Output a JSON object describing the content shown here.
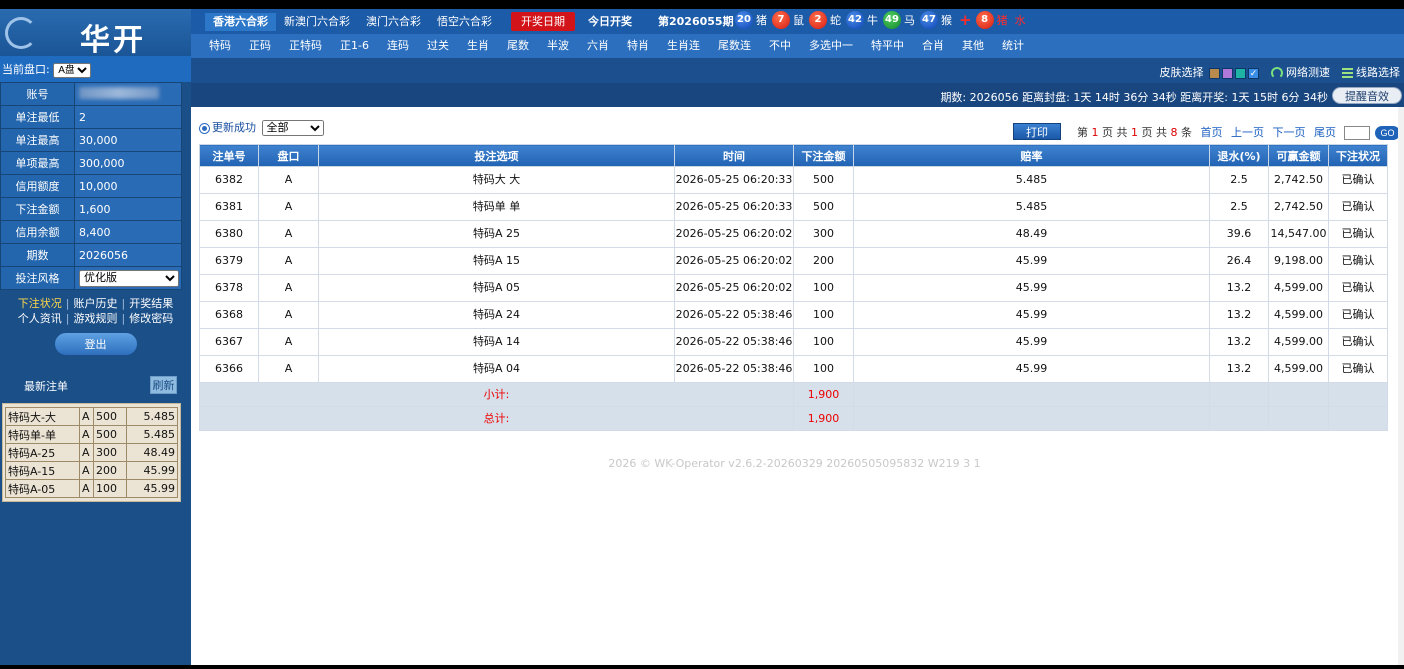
{
  "logo": {
    "name": "华开"
  },
  "sidebar": {
    "pan_label": "当前盘口:",
    "pan_value": "A盘",
    "info": [
      {
        "k": "账号",
        "v": ""
      },
      {
        "k": "单注最低",
        "v": "2"
      },
      {
        "k": "单注最高",
        "v": "30,000"
      },
      {
        "k": "单项最高",
        "v": "300,000"
      },
      {
        "k": "信用额度",
        "v": "10,000"
      },
      {
        "k": "下注金额",
        "v": "1,600"
      },
      {
        "k": "信用余额",
        "v": "8,400"
      },
      {
        "k": "期数",
        "v": "2026056"
      },
      {
        "k": "投注风格",
        "v": "优化版"
      }
    ],
    "links_row1": [
      "下注状况",
      "账户历史",
      "开奖结果"
    ],
    "links_row2": [
      "个人资讯",
      "游戏规则",
      "修改密码"
    ],
    "logout": "登出",
    "recent_title": "最新注单",
    "refresh": "刷新",
    "recent": [
      {
        "item": "特码大-大",
        "pan": "A",
        "amt": "500",
        "odds": "5.485"
      },
      {
        "item": "特码单-单",
        "pan": "A",
        "amt": "500",
        "odds": "5.485"
      },
      {
        "item": "特码A-25",
        "pan": "A",
        "amt": "300",
        "odds": "48.49"
      },
      {
        "item": "特码A-15",
        "pan": "A",
        "amt": "200",
        "odds": "45.99"
      },
      {
        "item": "特码A-05",
        "pan": "A",
        "amt": "100",
        "odds": "45.99"
      }
    ]
  },
  "top": {
    "tabs": [
      "香港六合彩",
      "新澳门六合彩",
      "澳门六合彩",
      "悟空六合彩"
    ],
    "draw_date_btn": "开奖日期",
    "today": "今日开奖",
    "period": "第2026055期",
    "balls": [
      {
        "n": "20",
        "color": "blue",
        "zodiac": "猪"
      },
      {
        "n": "7",
        "color": "red",
        "zodiac": "鼠"
      },
      {
        "n": "2",
        "color": "red",
        "zodiac": "蛇"
      },
      {
        "n": "42",
        "color": "blue",
        "zodiac": "牛"
      },
      {
        "n": "49",
        "color": "green",
        "zodiac": "马"
      },
      {
        "n": "47",
        "color": "blue",
        "zodiac": "猴"
      }
    ],
    "special": {
      "n": "8",
      "color": "red",
      "zodiac": "猪",
      "extra": "水"
    }
  },
  "nav": [
    "特码",
    "正码",
    "正特码",
    "正1-6",
    "连码",
    "过关",
    "生肖",
    "尾数",
    "半波",
    "六肖",
    "特肖",
    "生肖连",
    "尾数连",
    "不中",
    "多选中一",
    "特平中",
    "合肖",
    "其他",
    "统计"
  ],
  "toolbar": {
    "skin_label": "皮肤选择",
    "skin_colors": [
      "#b88a4e",
      "#b078d8",
      "#1fb3a6",
      "#3a8ee6"
    ],
    "netspeed": "网络测速",
    "lines": "线路选择",
    "status_text": "期数: 2026056   距离封盘: 1天 14时 36分 34秒  距离开奖: 1天 15时 6分 34秒",
    "sound_btn": "提醒音效"
  },
  "filter": {
    "label": "更新成功",
    "value": "全部"
  },
  "print_btn": "打印",
  "pager": {
    "page": "1",
    "total_pages": "1",
    "total_items": "8",
    "first": "首页",
    "prev": "上一页",
    "next": "下一页",
    "last": "尾页",
    "go": "GO"
  },
  "table": {
    "headers": [
      "注单号",
      "盘口",
      "投注选项",
      "时间",
      "下注金额",
      "赔率",
      "退水(%)",
      "可赢金额",
      "下注状况"
    ],
    "rows": [
      [
        "6382",
        "A",
        "特码大 大",
        "2026-05-25 06:20:33",
        "500",
        "5.485",
        "2.5",
        "2,742.50",
        "已确认"
      ],
      [
        "6381",
        "A",
        "特码单 单",
        "2026-05-25 06:20:33",
        "500",
        "5.485",
        "2.5",
        "2,742.50",
        "已确认"
      ],
      [
        "6380",
        "A",
        "特码A 25",
        "2026-05-25 06:20:02",
        "300",
        "48.49",
        "39.6",
        "14,547.00",
        "已确认"
      ],
      [
        "6379",
        "A",
        "特码A 15",
        "2026-05-25 06:20:02",
        "200",
        "45.99",
        "26.4",
        "9,198.00",
        "已确认"
      ],
      [
        "6378",
        "A",
        "特码A 05",
        "2026-05-25 06:20:02",
        "100",
        "45.99",
        "13.2",
        "4,599.00",
        "已确认"
      ],
      [
        "6368",
        "A",
        "特码A 24",
        "2026-05-22 05:38:46",
        "100",
        "45.99",
        "13.2",
        "4,599.00",
        "已确认"
      ],
      [
        "6367",
        "A",
        "特码A 14",
        "2026-05-22 05:38:46",
        "100",
        "45.99",
        "13.2",
        "4,599.00",
        "已确认"
      ],
      [
        "6366",
        "A",
        "特码A 04",
        "2026-05-22 05:38:46",
        "100",
        "45.99",
        "13.2",
        "4,599.00",
        "已确认"
      ]
    ],
    "subtotal_label": "小计:",
    "subtotal": "1,900",
    "total_label": "总计:",
    "total": "1,900"
  },
  "footer": "2026 © WK-Operator v2.6.2-20260329 20260505095832 W219 3 1"
}
